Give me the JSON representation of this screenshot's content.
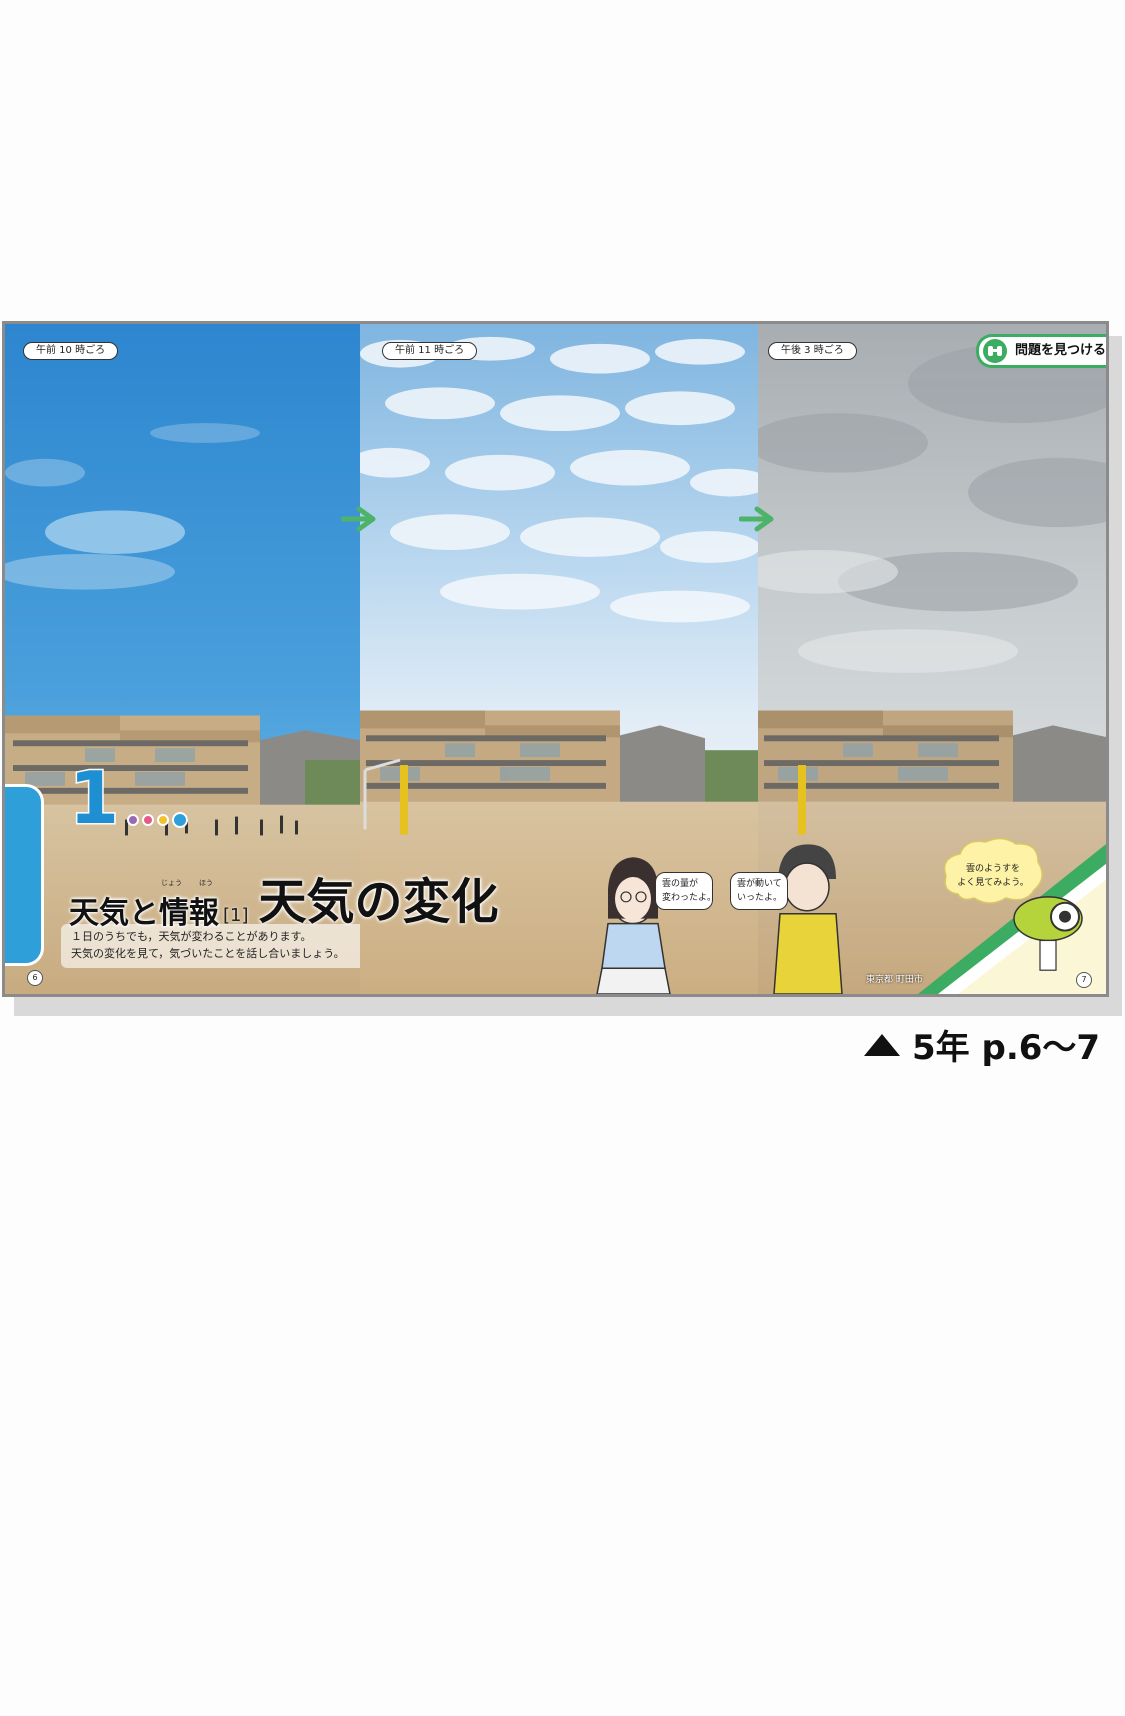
{
  "panels": {
    "p1": {
      "time_label": "午前 10 時ごろ"
    },
    "p2": {
      "time_label": "午前 11 時ごろ"
    },
    "p3": {
      "time_label": "午後 3 時ごろ"
    }
  },
  "unit": {
    "number": "1",
    "dot_colors": [
      "#9b6ab5",
      "#e35b8a",
      "#f2c12e",
      "#2f9fd9"
    ],
    "series_title": "天気と情報",
    "series_ruby_1": "じょう",
    "series_ruby_2": "ほう",
    "series_index": "[1]",
    "title": "天気の変化",
    "intro_lines": [
      "１日のうちでも，天気が変わることがあります。",
      "天気の変化を見て，気づいたことを話し合いましょう。"
    ]
  },
  "speech": {
    "girl": [
      "雲の量が",
      "変わったよ。"
    ],
    "boy": [
      "雲が動いて",
      "いったよ。"
    ],
    "mascot": [
      "雲のようすを",
      "よく見てみよう。"
    ]
  },
  "badge": {
    "label": "問題を見つける",
    "icon": "binoculars-icon"
  },
  "location": "東京都 町田市",
  "page_numbers": {
    "left": "6",
    "right": "7"
  },
  "caption": {
    "text": "5年 p.6〜7"
  },
  "colors": {
    "accent_blue": "#2f9fd9",
    "accent_green": "#3dac63",
    "arrow_green": "#4db36a"
  }
}
